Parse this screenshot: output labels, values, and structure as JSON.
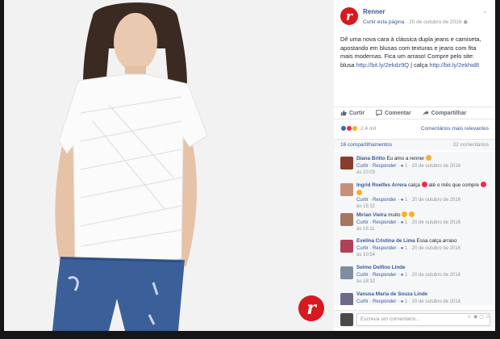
{
  "post": {
    "page_name": "Renner",
    "like_page": "Curtir esta página",
    "sep": " · ",
    "date": "20 de outubro de 2016",
    "text": "Dê uma nova cara à clássica dupla jeans e camiseta, apostando em blusas com texturas e jeans com fita mais modernas. Fica um arraso! Compre pelo site: blusa",
    "link1": "http://bit.ly/2ekdz9Q",
    "text_mid": " | calça",
    "link2": "http://bit.ly/2ekhid8",
    "brand_letter": "r"
  },
  "actions": {
    "like": "Curtir",
    "comment": "Comentar",
    "share": "Compartilhar"
  },
  "reactions": {
    "count": "2,4 mil",
    "sort": "Comentários mais relevantes"
  },
  "stats": {
    "shares": "16 compartilhamentos",
    "comments": "32 comentários"
  },
  "comments": [
    {
      "author": "Diana Britto",
      "text": "Eu amo a renner",
      "meta_reply": "Curtir · Responder · ",
      "meta_count": "1",
      "meta_time": " · 20 de outubro de 2016",
      "meta_time2": "às 10:03"
    },
    {
      "author": "Ingrid Roelfes Arrera",
      "text": "calça ",
      "text2": " até o mês que compre ",
      "meta_reply": "Curtir · Responder · ",
      "meta_count": "1",
      "meta_time": " · 20 de outubro de 2016",
      "meta_time2": "às 15:32"
    },
    {
      "author": "Mirian Vieira",
      "text": "muito ",
      "meta_reply": "Curtir · Responder · ",
      "meta_count": "1",
      "meta_time": " · 20 de outubro de 2016",
      "meta_time2": "às 16:11"
    },
    {
      "author": "Evelina Cristina de Lima",
      "text": "Essa calça arraso",
      "meta_reply": "Curtir · Responder · ",
      "meta_count": "1",
      "meta_time": " · 20 de outubro de 2016",
      "meta_time2": "às 10:54"
    },
    {
      "author": "Selmo Delfino Linde",
      "text": "",
      "meta_reply": "Curtir · Responder · ",
      "meta_count": "1",
      "meta_time": " · 20 de outubro de 2016",
      "meta_time2": "às 18:32"
    },
    {
      "author": "Vanusa Maria de Souza Linde",
      "text": "",
      "meta_reply": "Curtir · Responder · ",
      "meta_count": "1",
      "meta_time": " · 20 de outubro de 2016",
      "meta_time2": ""
    }
  ],
  "composer": {
    "placeholder": "Escreva um comentário..."
  },
  "colors": {
    "brand": "#d71920",
    "fb_link": "#365899",
    "like_blue": "#4267b2",
    "heart": "#f0284a",
    "haha": "#f7b125"
  }
}
